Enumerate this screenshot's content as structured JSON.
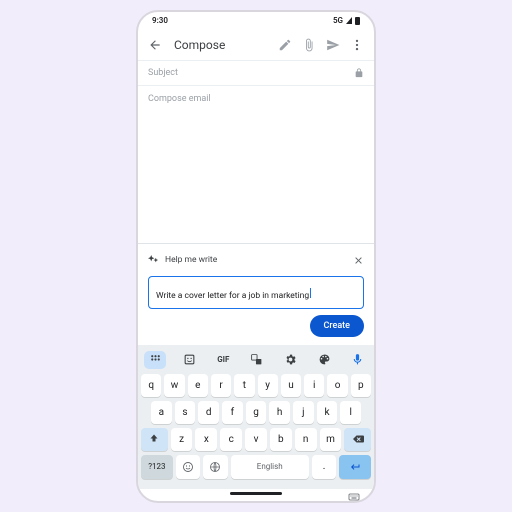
{
  "status": {
    "time": "9:30",
    "signal": "5G"
  },
  "header": {
    "title": "Compose"
  },
  "subject": {
    "placeholder": "Subject"
  },
  "body": {
    "placeholder": "Compose email"
  },
  "panel": {
    "title": "Help me write",
    "prompt": "Write a cover letter for a job in marketing",
    "create_label": "Create"
  },
  "kb": {
    "gif": "GIF",
    "row1": [
      "q",
      "w",
      "e",
      "r",
      "t",
      "y",
      "u",
      "i",
      "o",
      "p"
    ],
    "row2": [
      "a",
      "s",
      "d",
      "f",
      "g",
      "h",
      "j",
      "k",
      "l"
    ],
    "row3": [
      "z",
      "x",
      "c",
      "v",
      "b",
      "n",
      "m"
    ],
    "sym": "?123",
    "space": "English",
    "period": "."
  }
}
